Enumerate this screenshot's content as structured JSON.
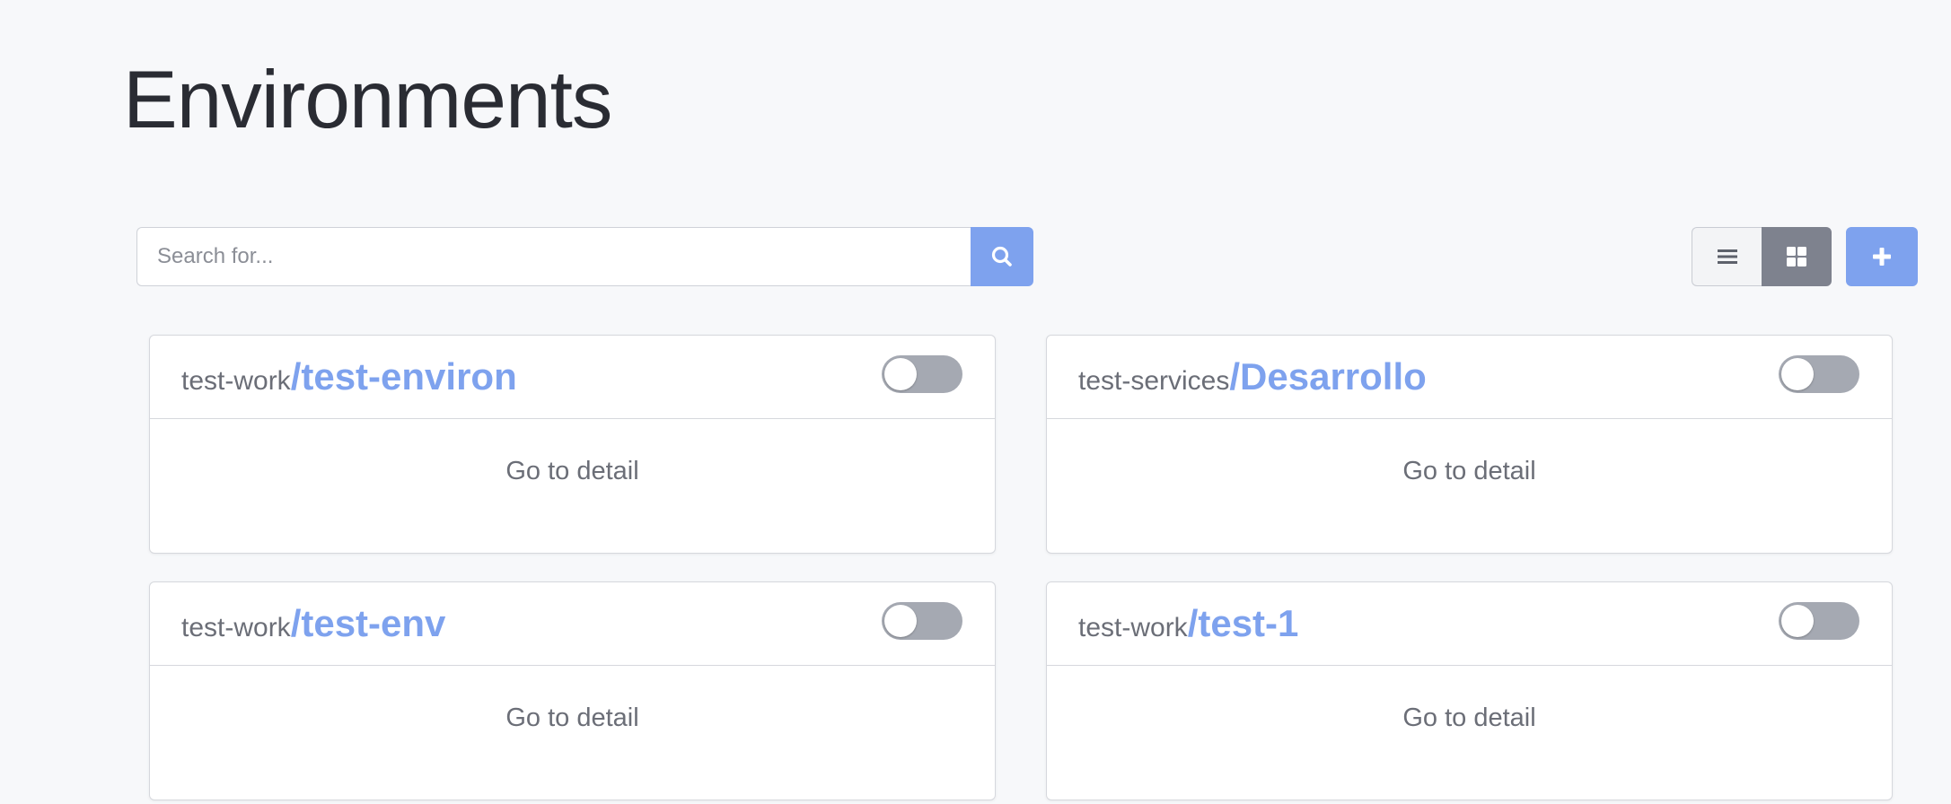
{
  "page": {
    "title": "Environments"
  },
  "search": {
    "placeholder": "Search for...",
    "value": "",
    "button_icon": "search-icon"
  },
  "toolbar": {
    "list_view_icon": "list-icon",
    "grid_view_icon": "grid-icon",
    "active_view": "grid",
    "add_icon": "plus-icon"
  },
  "colors": {
    "accent": "#7ea2ee",
    "active_view_bg": "#7e828e",
    "toggle_off": "#a5a9b2",
    "background": "#f7f8fa"
  },
  "environments": [
    {
      "org": "test-work",
      "name": "/test-environ",
      "enabled": false,
      "detail_label": "Go to detail"
    },
    {
      "org": "test-services",
      "name": "/Desarrollo",
      "enabled": false,
      "detail_label": "Go to detail"
    },
    {
      "org": "test-work",
      "name": "/test-env",
      "enabled": false,
      "detail_label": "Go to detail"
    },
    {
      "org": "test-work",
      "name": "/test-1",
      "enabled": false,
      "detail_label": "Go to detail"
    }
  ]
}
